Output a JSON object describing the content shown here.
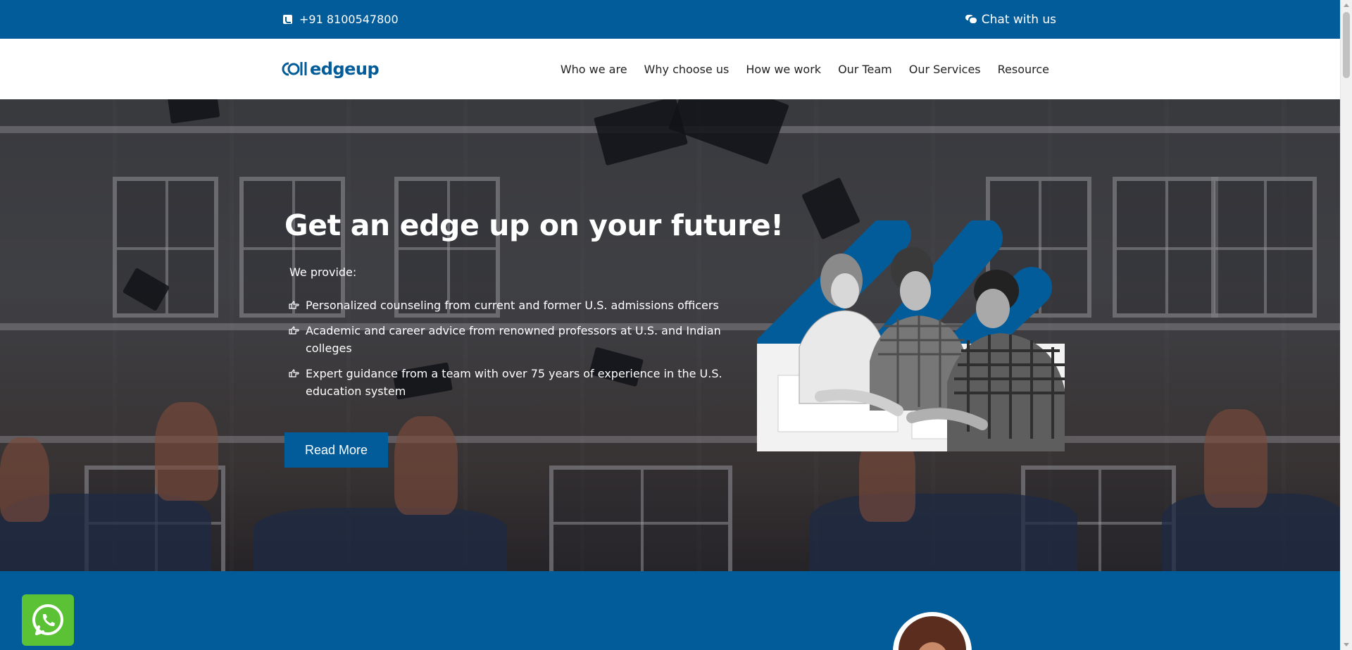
{
  "topbar": {
    "phone": "+91 8100547800",
    "phone_icon": "phone-icon",
    "chat": "Chat with us",
    "chat_icon": "chat-bubbles-icon",
    "background": "#035c9a"
  },
  "header": {
    "logo_text": "edgeup",
    "nav": [
      {
        "label": "Who we are"
      },
      {
        "label": "Why choose us"
      },
      {
        "label": "How we work"
      },
      {
        "label": "Our Team"
      },
      {
        "label": "Our Services"
      },
      {
        "label": "Resource"
      }
    ]
  },
  "hero": {
    "title": "Get an edge up on your future!",
    "provide_label": "We provide:",
    "features": [
      {
        "text": "Personalized counseling from current and former U.S. admissions officers"
      },
      {
        "text": "Academic and career advice from renowned professors at U.S. and Indian colleges"
      },
      {
        "text": "Expert guidance from a team with over 75 years of experience in the U.S. education system"
      }
    ],
    "bullet_icon": "hand-pointing-icon",
    "cta": "Read More",
    "image": "students-studying-photo"
  },
  "floating": {
    "whatsapp_icon": "whatsapp-icon",
    "whatsapp_color": "#5bc236"
  },
  "colors": {
    "brand": "#035c9a",
    "white": "#ffffff"
  }
}
